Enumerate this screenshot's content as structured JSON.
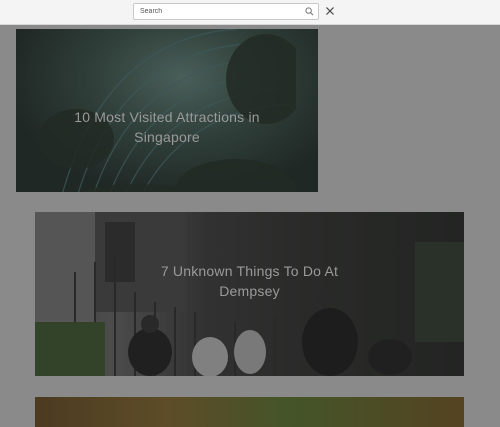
{
  "search": {
    "placeholder": "Search",
    "value": ""
  },
  "articles": [
    {
      "title": "10 Most Visited Attractions in Singapore",
      "meta": [
        "",
        ""
      ]
    },
    {
      "title": "7 Unknown Things To Do At Dempsey"
    },
    {
      "title": ""
    }
  ],
  "colors": {
    "overlay": "#8a8a8a",
    "search_bar": "#f4f4f4"
  },
  "icons": {
    "search": "search-icon",
    "close": "close-icon"
  }
}
